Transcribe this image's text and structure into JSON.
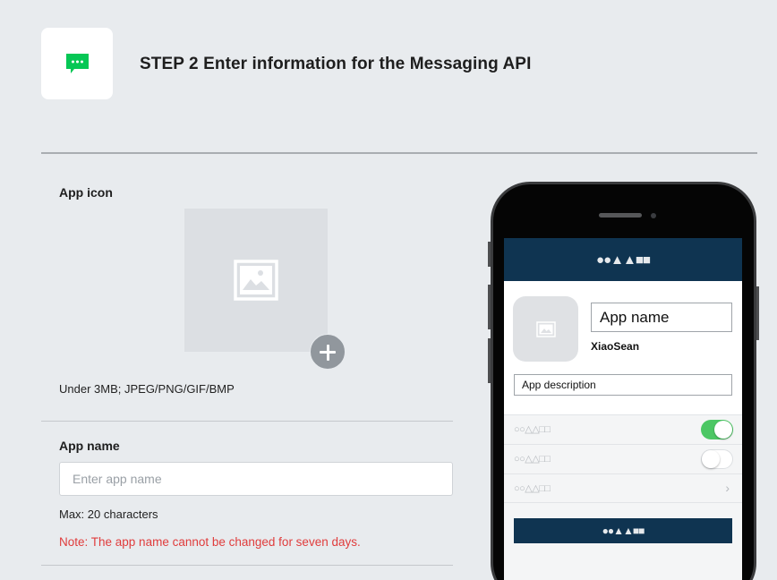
{
  "header": {
    "title": "STEP 2 Enter information for the Messaging API",
    "icon": "messaging-icon",
    "icon_color": "#06c755"
  },
  "form": {
    "app_icon": {
      "label": "App icon",
      "hint": "Under 3MB; JPEG/PNG/GIF/BMP",
      "placeholder_icon": "image-icon",
      "add_icon": "plus-icon"
    },
    "app_name": {
      "label": "App name",
      "placeholder": "Enter app name",
      "value": "",
      "max_text": "Max: 20 characters",
      "note": "Note: The app name cannot be changed for seven days.",
      "note_color": "#e03c3c"
    }
  },
  "preview": {
    "header_symbols": "●●▲▲■■",
    "app_name": "App name",
    "user_name": "XiaoSean",
    "app_description": "App description",
    "rows": [
      {
        "label": "○○△△□□",
        "control": "toggle",
        "on": true
      },
      {
        "label": "○○△△□□",
        "control": "toggle",
        "on": false
      },
      {
        "label": "○○△△□□",
        "control": "chevron",
        "icon": "chevron-right-icon"
      }
    ],
    "button_symbols": "●●▲▲■■",
    "accent_color": "#0f3451",
    "toggle_on_color": "#4cc764"
  }
}
